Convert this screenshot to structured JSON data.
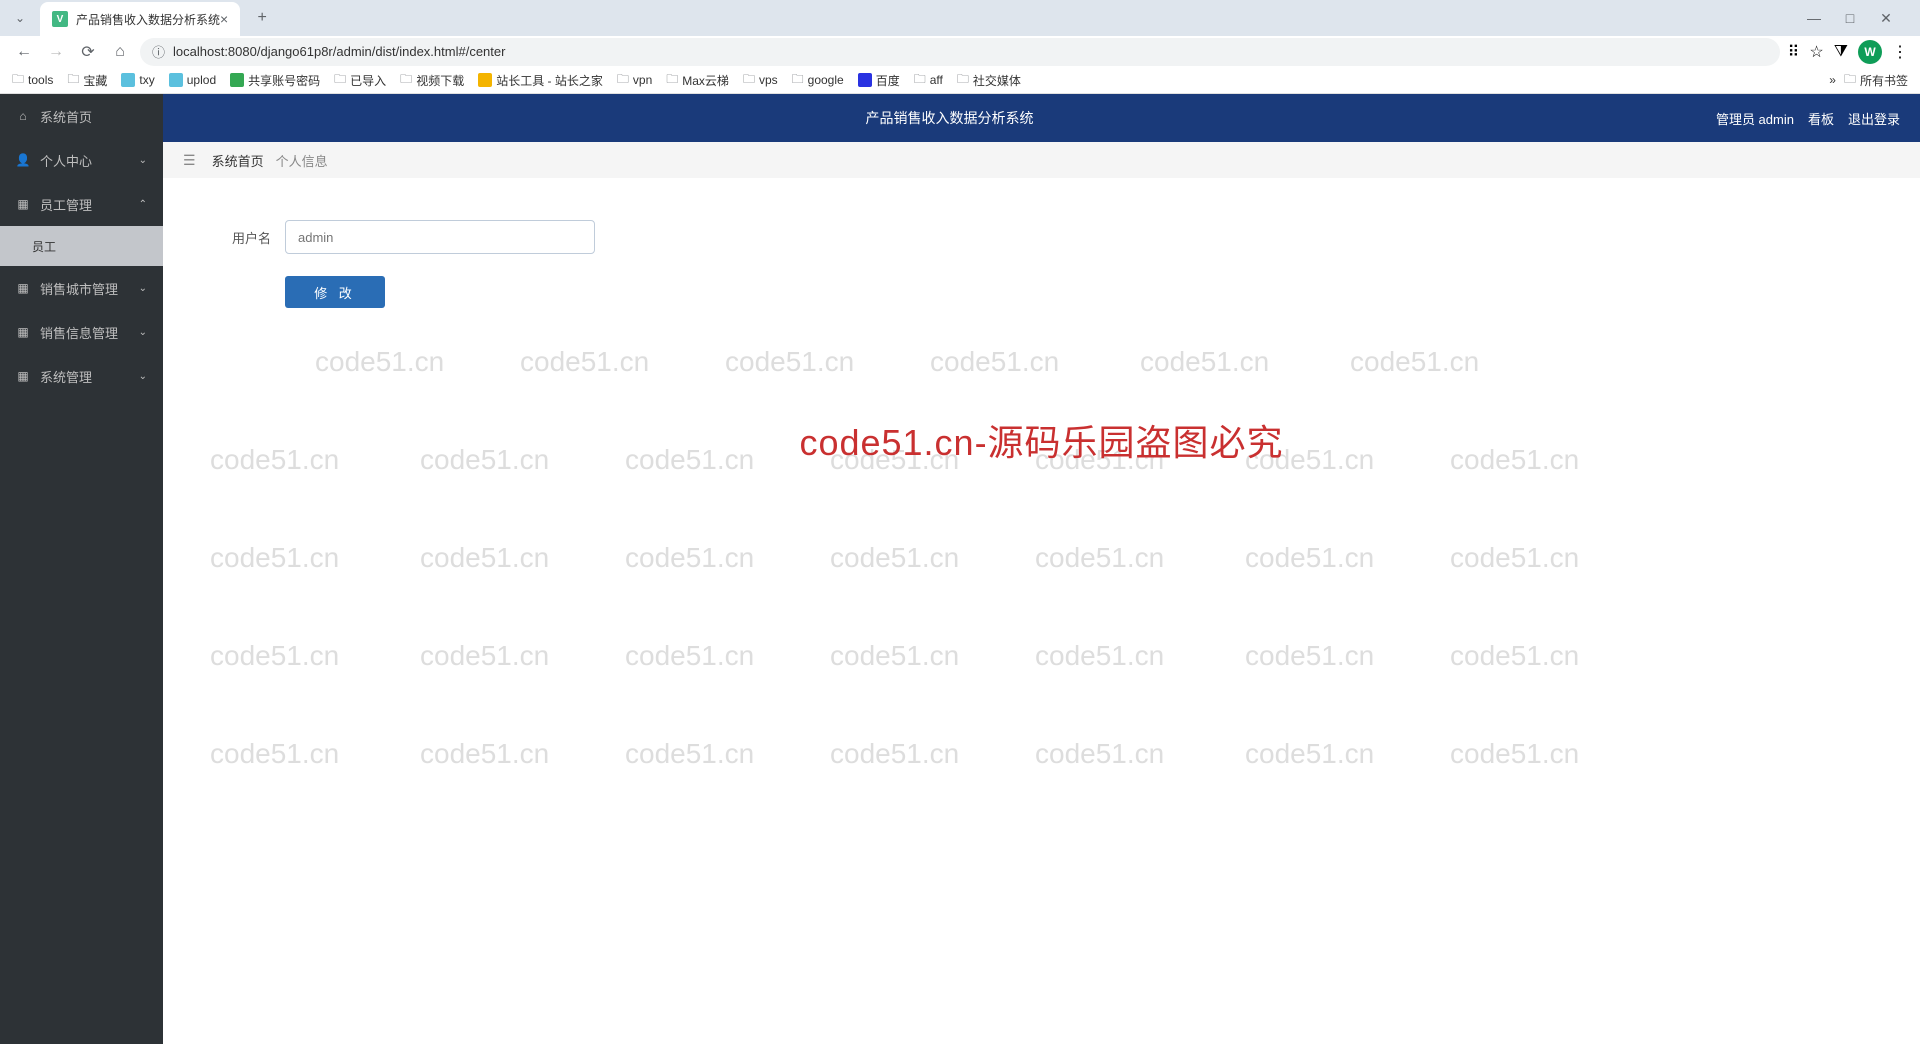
{
  "browser": {
    "tab_title": "产品销售收入数据分析系统",
    "url": "localhost:8080/django61p8r/admin/dist/index.html#/center",
    "profile_letter": "W",
    "bookmarks": [
      "tools",
      "宝藏",
      "txy",
      "uplod",
      "共享账号密码",
      "已导入",
      "视频下载",
      "站长工具 - 站长之家",
      "vpn",
      "Max云梯",
      "vps",
      "google",
      "百度",
      "aff",
      "社交媒体"
    ],
    "all_bookmarks": "所有书签"
  },
  "sidebar": {
    "items": [
      {
        "icon": "home",
        "label": "系统首页"
      },
      {
        "icon": "user",
        "label": "个人中心",
        "chevron": "down"
      },
      {
        "icon": "grid",
        "label": "员工管理",
        "chevron": "up"
      },
      {
        "icon": "module",
        "label": "销售城市管理",
        "chevron": "down"
      },
      {
        "icon": "module",
        "label": "销售信息管理",
        "chevron": "down"
      },
      {
        "icon": "module",
        "label": "系统管理",
        "chevron": "down"
      }
    ],
    "sub_item": "员工"
  },
  "topbar": {
    "title": "产品销售收入数据分析系统",
    "user_label": "管理员 admin",
    "kanban": "看板",
    "logout": "退出登录"
  },
  "breadcrumb": {
    "home": "系统首页",
    "current": "个人信息"
  },
  "form": {
    "username_label": "用户名",
    "username_placeholder": "admin",
    "submit_label": "修 改"
  },
  "watermark_text": "code51.cn",
  "big_watermark": "code51.cn-源码乐园盗图必究"
}
